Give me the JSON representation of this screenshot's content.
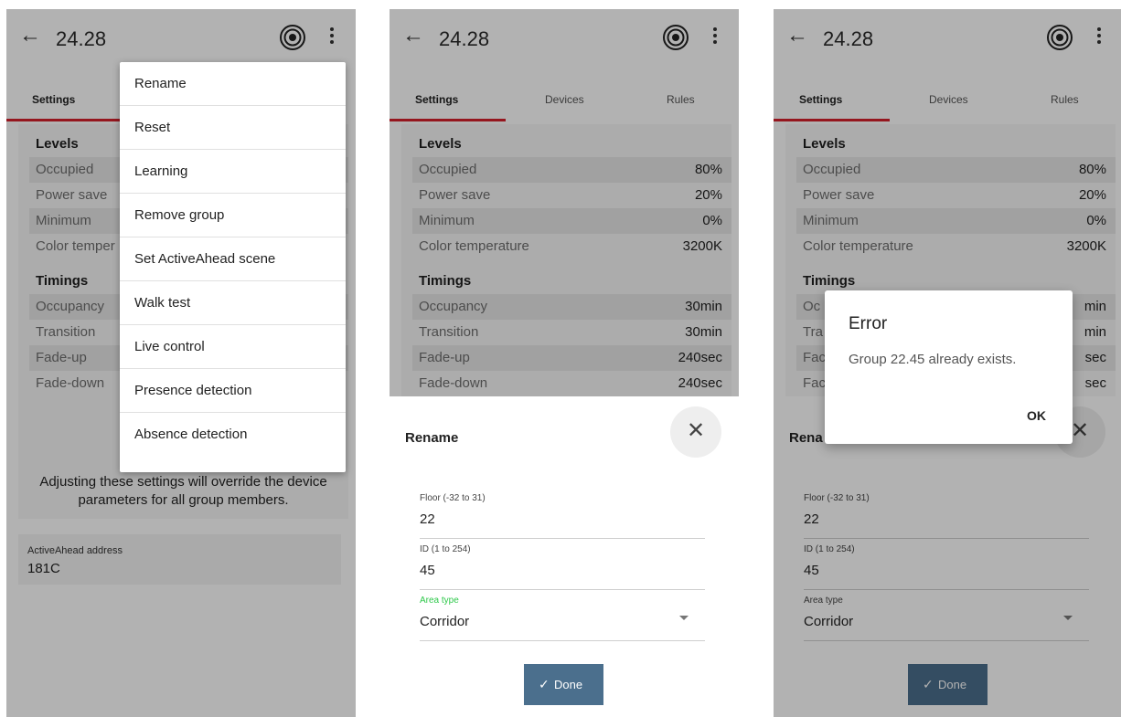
{
  "header": {
    "back_glyph": "←",
    "title": "24.28",
    "radar_icon": "radar-icon",
    "more_icon": "more-vertical-icon"
  },
  "tabs": [
    "Settings",
    "Devices",
    "Rules"
  ],
  "accent_color": "#d6202b",
  "levels": {
    "heading": "Levels",
    "rows": [
      {
        "label": "Occupied",
        "value": "80%"
      },
      {
        "label": "Power save",
        "value": "20%"
      },
      {
        "label": "Minimum",
        "value": "0%"
      },
      {
        "label": "Color temperature",
        "value": "3200K"
      }
    ]
  },
  "timings": {
    "heading": "Timings",
    "rows": [
      {
        "label": "Occupancy",
        "value": "30min"
      },
      {
        "label": "Transition",
        "value": "30min"
      },
      {
        "label": "Fade-up",
        "value": "240sec"
      },
      {
        "label": "Fade-down",
        "value": "240sec"
      }
    ]
  },
  "note": "Adjusting these settings will override the device parameters for all group members.",
  "address": {
    "label": "ActiveAhead address",
    "value": "181C"
  },
  "menu": {
    "items": [
      "Rename",
      "Reset",
      "Learning",
      "Remove group",
      "Set ActiveAhead scene",
      "Walk test",
      "Live control",
      "Presence detection",
      "Absence detection"
    ]
  },
  "rename": {
    "title": "Rename",
    "close_glyph": "✕",
    "floor": {
      "label": "Floor (-32 to 31)",
      "value": "22"
    },
    "id": {
      "label": "ID (1 to 254)",
      "value": "45"
    },
    "area": {
      "label": "Area type",
      "value": "Corridor"
    },
    "done_check": "✓",
    "done_label": "Done",
    "button_color": "#4b6f8d",
    "focus_color": "#2ec84a"
  },
  "error_dialog": {
    "title": "Error",
    "message": "Group 22.45 already exists.",
    "ok_label": "OK"
  },
  "partial": {
    "color_temp": "Color temper",
    "rename_title": "Rena",
    "timing_values": [
      "min",
      "min",
      "sec",
      "sec"
    ],
    "timing_labels": [
      "Oc",
      "Tra",
      "Fac",
      "Fac"
    ]
  }
}
